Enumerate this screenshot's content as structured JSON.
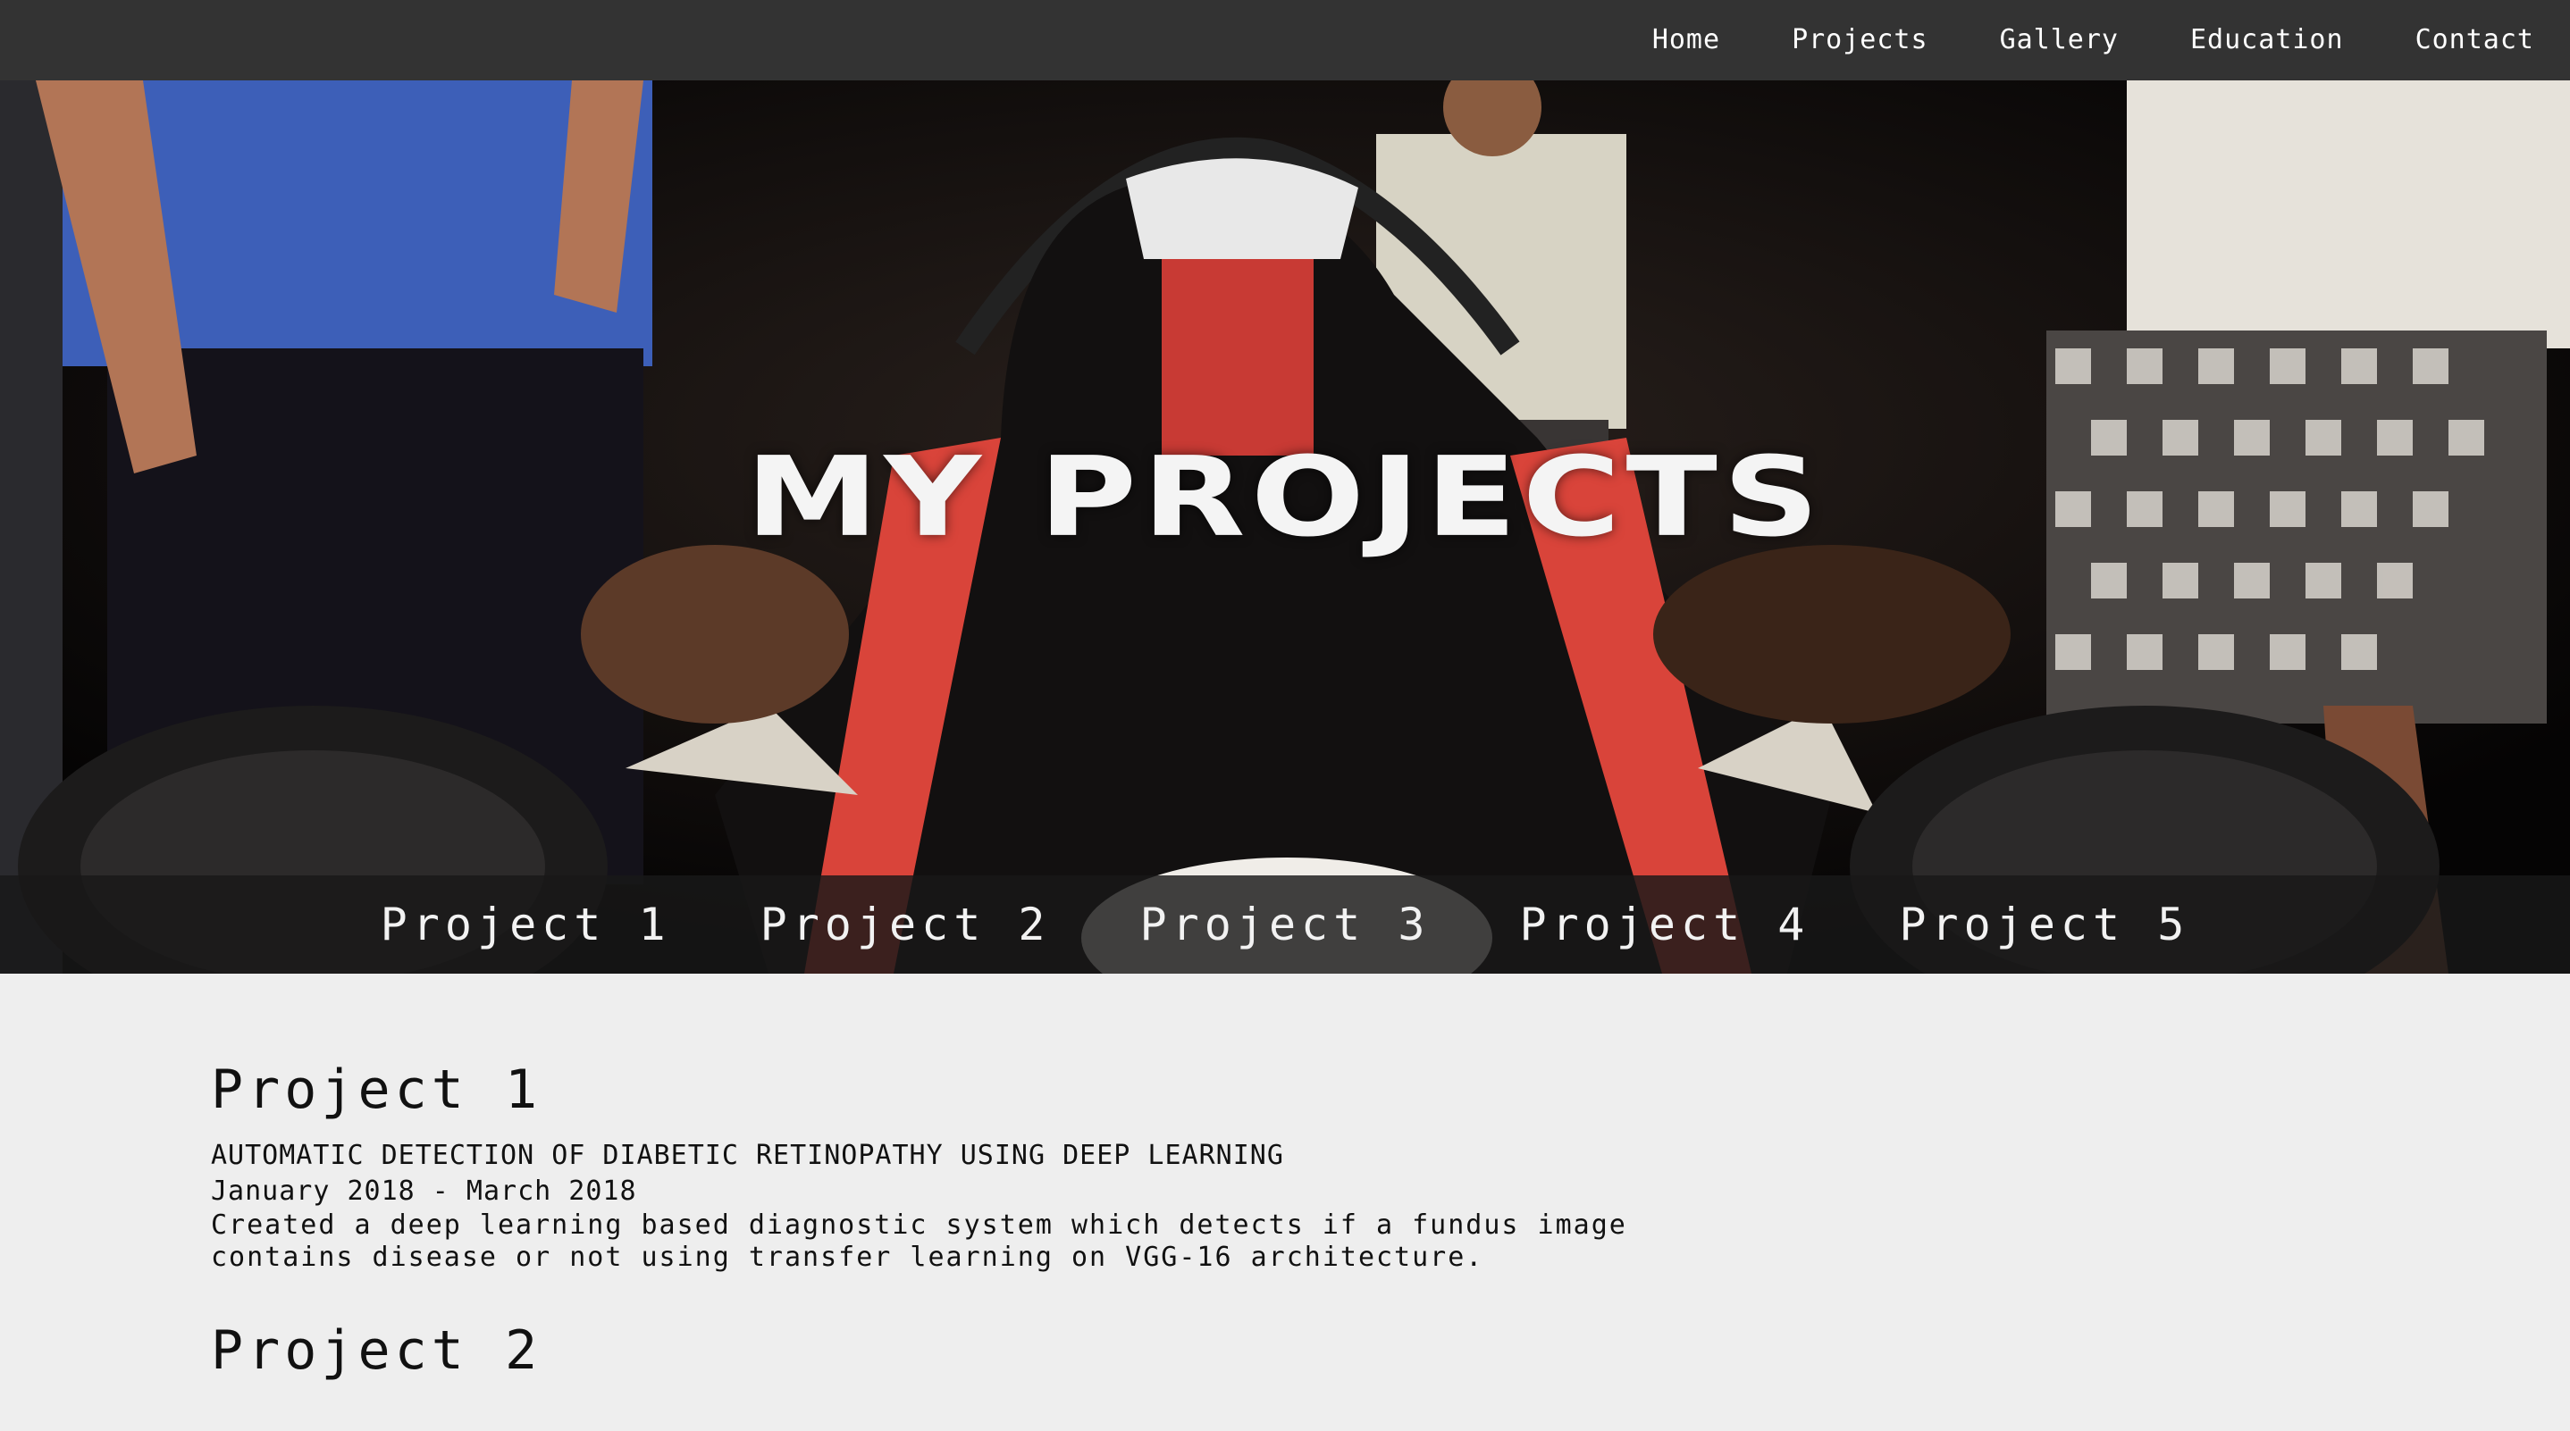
{
  "topnav": {
    "items": [
      "Home",
      "Projects",
      "Gallery",
      "Education",
      "Contact"
    ]
  },
  "hero": {
    "title": "MY PROJECTS",
    "image_description_name": "race-car-hero-image"
  },
  "subnav": {
    "items": [
      "Project 1",
      "Project 2",
      "Project 3",
      "Project 4",
      "Project 5"
    ]
  },
  "projects": [
    {
      "heading": "Project 1",
      "title": "AUTOMATIC DETECTION OF DIABETIC RETINOPATHY USING DEEP LEARNING",
      "date": "January 2018 - March 2018",
      "description": "Created a deep learning based diagnostic system which detects if a fundus image contains disease or not using transfer learning on VGG-16 architecture."
    },
    {
      "heading": "Project 2"
    }
  ],
  "colors": {
    "nav_bg": "#333333",
    "page_bg": "#eeeeee",
    "text": "#111111",
    "accent_red": "#d9443a"
  }
}
